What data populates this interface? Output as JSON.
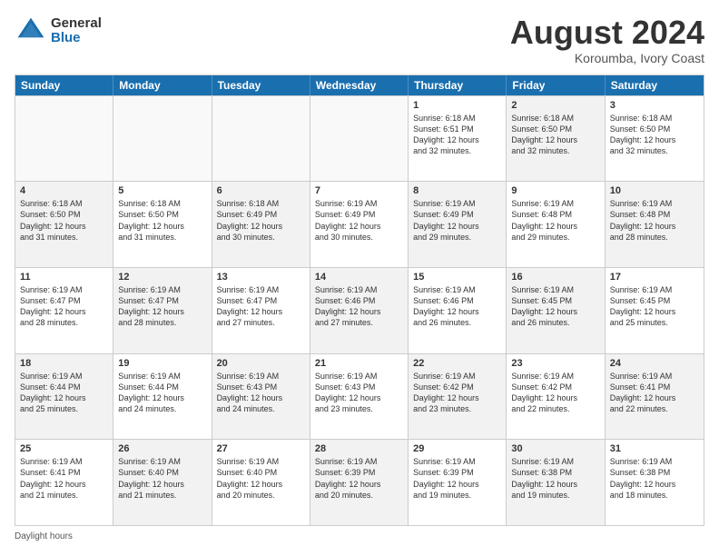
{
  "header": {
    "logo_general": "General",
    "logo_blue": "Blue",
    "title": "August 2024",
    "location": "Koroumba, Ivory Coast"
  },
  "calendar": {
    "days_of_week": [
      "Sunday",
      "Monday",
      "Tuesday",
      "Wednesday",
      "Thursday",
      "Friday",
      "Saturday"
    ],
    "footer": "Daylight hours",
    "rows": [
      [
        {
          "day": "",
          "detail": "",
          "empty": true
        },
        {
          "day": "",
          "detail": "",
          "empty": true
        },
        {
          "day": "",
          "detail": "",
          "empty": true
        },
        {
          "day": "",
          "detail": "",
          "empty": true
        },
        {
          "day": "1",
          "detail": "Sunrise: 6:18 AM\nSunset: 6:51 PM\nDaylight: 12 hours\nand 32 minutes.",
          "shaded": false
        },
        {
          "day": "2",
          "detail": "Sunrise: 6:18 AM\nSunset: 6:50 PM\nDaylight: 12 hours\nand 32 minutes.",
          "shaded": true
        },
        {
          "day": "3",
          "detail": "Sunrise: 6:18 AM\nSunset: 6:50 PM\nDaylight: 12 hours\nand 32 minutes.",
          "shaded": false
        }
      ],
      [
        {
          "day": "4",
          "detail": "Sunrise: 6:18 AM\nSunset: 6:50 PM\nDaylight: 12 hours\nand 31 minutes.",
          "shaded": true
        },
        {
          "day": "5",
          "detail": "Sunrise: 6:18 AM\nSunset: 6:50 PM\nDaylight: 12 hours\nand 31 minutes.",
          "shaded": false
        },
        {
          "day": "6",
          "detail": "Sunrise: 6:18 AM\nSunset: 6:49 PM\nDaylight: 12 hours\nand 30 minutes.",
          "shaded": true
        },
        {
          "day": "7",
          "detail": "Sunrise: 6:19 AM\nSunset: 6:49 PM\nDaylight: 12 hours\nand 30 minutes.",
          "shaded": false
        },
        {
          "day": "8",
          "detail": "Sunrise: 6:19 AM\nSunset: 6:49 PM\nDaylight: 12 hours\nand 29 minutes.",
          "shaded": true
        },
        {
          "day": "9",
          "detail": "Sunrise: 6:19 AM\nSunset: 6:48 PM\nDaylight: 12 hours\nand 29 minutes.",
          "shaded": false
        },
        {
          "day": "10",
          "detail": "Sunrise: 6:19 AM\nSunset: 6:48 PM\nDaylight: 12 hours\nand 28 minutes.",
          "shaded": true
        }
      ],
      [
        {
          "day": "11",
          "detail": "Sunrise: 6:19 AM\nSunset: 6:47 PM\nDaylight: 12 hours\nand 28 minutes.",
          "shaded": false
        },
        {
          "day": "12",
          "detail": "Sunrise: 6:19 AM\nSunset: 6:47 PM\nDaylight: 12 hours\nand 28 minutes.",
          "shaded": true
        },
        {
          "day": "13",
          "detail": "Sunrise: 6:19 AM\nSunset: 6:47 PM\nDaylight: 12 hours\nand 27 minutes.",
          "shaded": false
        },
        {
          "day": "14",
          "detail": "Sunrise: 6:19 AM\nSunset: 6:46 PM\nDaylight: 12 hours\nand 27 minutes.",
          "shaded": true
        },
        {
          "day": "15",
          "detail": "Sunrise: 6:19 AM\nSunset: 6:46 PM\nDaylight: 12 hours\nand 26 minutes.",
          "shaded": false
        },
        {
          "day": "16",
          "detail": "Sunrise: 6:19 AM\nSunset: 6:45 PM\nDaylight: 12 hours\nand 26 minutes.",
          "shaded": true
        },
        {
          "day": "17",
          "detail": "Sunrise: 6:19 AM\nSunset: 6:45 PM\nDaylight: 12 hours\nand 25 minutes.",
          "shaded": false
        }
      ],
      [
        {
          "day": "18",
          "detail": "Sunrise: 6:19 AM\nSunset: 6:44 PM\nDaylight: 12 hours\nand 25 minutes.",
          "shaded": true
        },
        {
          "day": "19",
          "detail": "Sunrise: 6:19 AM\nSunset: 6:44 PM\nDaylight: 12 hours\nand 24 minutes.",
          "shaded": false
        },
        {
          "day": "20",
          "detail": "Sunrise: 6:19 AM\nSunset: 6:43 PM\nDaylight: 12 hours\nand 24 minutes.",
          "shaded": true
        },
        {
          "day": "21",
          "detail": "Sunrise: 6:19 AM\nSunset: 6:43 PM\nDaylight: 12 hours\nand 23 minutes.",
          "shaded": false
        },
        {
          "day": "22",
          "detail": "Sunrise: 6:19 AM\nSunset: 6:42 PM\nDaylight: 12 hours\nand 23 minutes.",
          "shaded": true
        },
        {
          "day": "23",
          "detail": "Sunrise: 6:19 AM\nSunset: 6:42 PM\nDaylight: 12 hours\nand 22 minutes.",
          "shaded": false
        },
        {
          "day": "24",
          "detail": "Sunrise: 6:19 AM\nSunset: 6:41 PM\nDaylight: 12 hours\nand 22 minutes.",
          "shaded": true
        }
      ],
      [
        {
          "day": "25",
          "detail": "Sunrise: 6:19 AM\nSunset: 6:41 PM\nDaylight: 12 hours\nand 21 minutes.",
          "shaded": false
        },
        {
          "day": "26",
          "detail": "Sunrise: 6:19 AM\nSunset: 6:40 PM\nDaylight: 12 hours\nand 21 minutes.",
          "shaded": true
        },
        {
          "day": "27",
          "detail": "Sunrise: 6:19 AM\nSunset: 6:40 PM\nDaylight: 12 hours\nand 20 minutes.",
          "shaded": false
        },
        {
          "day": "28",
          "detail": "Sunrise: 6:19 AM\nSunset: 6:39 PM\nDaylight: 12 hours\nand 20 minutes.",
          "shaded": true
        },
        {
          "day": "29",
          "detail": "Sunrise: 6:19 AM\nSunset: 6:39 PM\nDaylight: 12 hours\nand 19 minutes.",
          "shaded": false
        },
        {
          "day": "30",
          "detail": "Sunrise: 6:19 AM\nSunset: 6:38 PM\nDaylight: 12 hours\nand 19 minutes.",
          "shaded": true
        },
        {
          "day": "31",
          "detail": "Sunrise: 6:19 AM\nSunset: 6:38 PM\nDaylight: 12 hours\nand 18 minutes.",
          "shaded": false
        }
      ]
    ]
  }
}
